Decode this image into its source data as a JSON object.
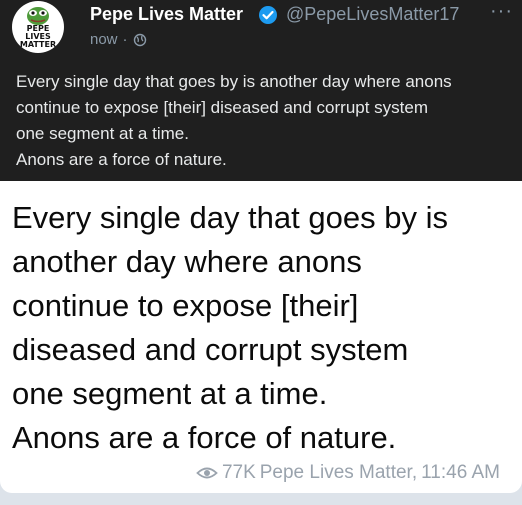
{
  "quoted_post": {
    "avatar_text": [
      "PEPE",
      "LIVES",
      "MATTER"
    ],
    "display_name": "Pepe Lives Matter",
    "handle": "@PepeLivesMatter17",
    "time": "now",
    "separator": "·",
    "more": "···",
    "text": "Every single day that goes by is another day where anons\ncontinue to expose [their] diseased and corrupt system\none segment at a time.\nAnons are a force of nature."
  },
  "message": {
    "text": "Every single day that goes by is\nanother day where anons\ncontinue to expose [their]\ndiseased and corrupt system\none segment at a time.\nAnons are a force of nature.",
    "views": "77K",
    "author": "Pepe Lives Matter,",
    "time": "11:46 AM"
  },
  "colors": {
    "quote_bg": "#1f1f1f",
    "verified": "#1d9bf0",
    "muted": "#8b9aa8",
    "footer": "#9aa3ad"
  },
  "icons": [
    "pepe-avatar-icon",
    "verified-badge-icon",
    "globe-icon",
    "more-icon",
    "eye-icon"
  ]
}
